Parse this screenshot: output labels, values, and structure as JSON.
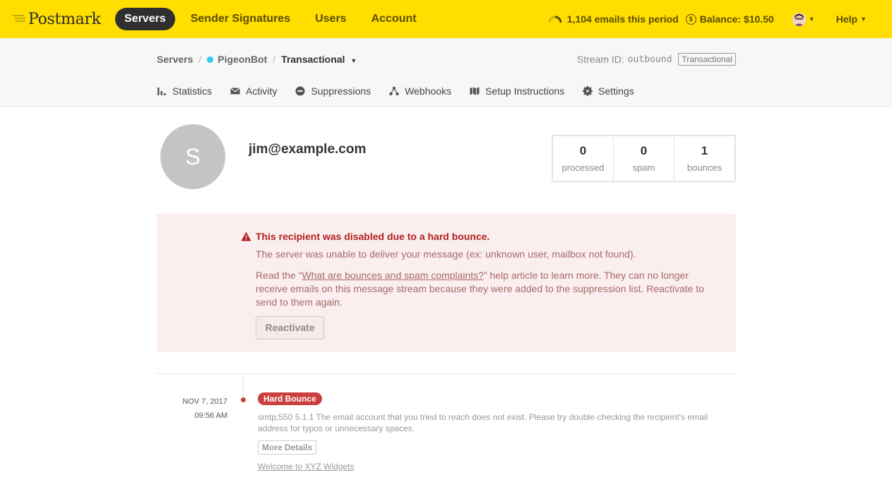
{
  "app": {
    "name": "Postmark"
  },
  "nav": {
    "items": [
      {
        "label": "Servers",
        "active": true
      },
      {
        "label": "Sender Signatures"
      },
      {
        "label": "Users"
      },
      {
        "label": "Account"
      }
    ]
  },
  "topright": {
    "emails_period": "1,104 emails this period",
    "balance": "Balance: $10.50",
    "help": "Help"
  },
  "breadcrumb": {
    "root": "Servers",
    "server": "PigeonBot",
    "stream": "Transactional",
    "server_status_color": "#2ec7f2"
  },
  "stream_id": {
    "label": "Stream ID:",
    "value": "outbound",
    "badge": "Transactional"
  },
  "tabs": [
    {
      "label": "Statistics",
      "icon": "bar-chart-icon"
    },
    {
      "label": "Activity",
      "icon": "envelope-icon"
    },
    {
      "label": "Suppressions",
      "icon": "minus-circle-icon"
    },
    {
      "label": "Webhooks",
      "icon": "webhook-icon"
    },
    {
      "label": "Setup Instructions",
      "icon": "map-icon"
    },
    {
      "label": "Settings",
      "icon": "gear-icon"
    }
  ],
  "recipient": {
    "initial": "S",
    "email": "jim@example.com",
    "stats": [
      {
        "value": "0",
        "label": "processed"
      },
      {
        "value": "0",
        "label": "spam"
      },
      {
        "value": "1",
        "label": "bounces"
      }
    ]
  },
  "alert": {
    "title": "This recipient was disabled due to a hard bounce.",
    "line1": "The server was unable to deliver your message (ex: unknown user, mailbox not found).",
    "p2_before": "Read the “",
    "p2_link": "What are bounces and spam complaints?",
    "p2_after": "” help article to learn more. They can no longer receive emails on this message stream because they were added to the suppression list. Reactivate to send to them again.",
    "button": "Reactivate"
  },
  "timeline": {
    "date": "NOV 7, 2017",
    "time": "09:56 AM",
    "badge": "Hard Bounce",
    "message": "smtp;550 5.1.1 The email account that you tried to reach does not exist. Please try double-checking the recipient's email address for typos or unnecessary spaces.",
    "more": "More Details",
    "link": "Welcome to XYZ Widgets"
  },
  "colors": {
    "topbar": "#ffde00",
    "alert_bg": "#fbeeee",
    "alert_title": "#b0201e",
    "bounce_badge": "#c9403f"
  }
}
